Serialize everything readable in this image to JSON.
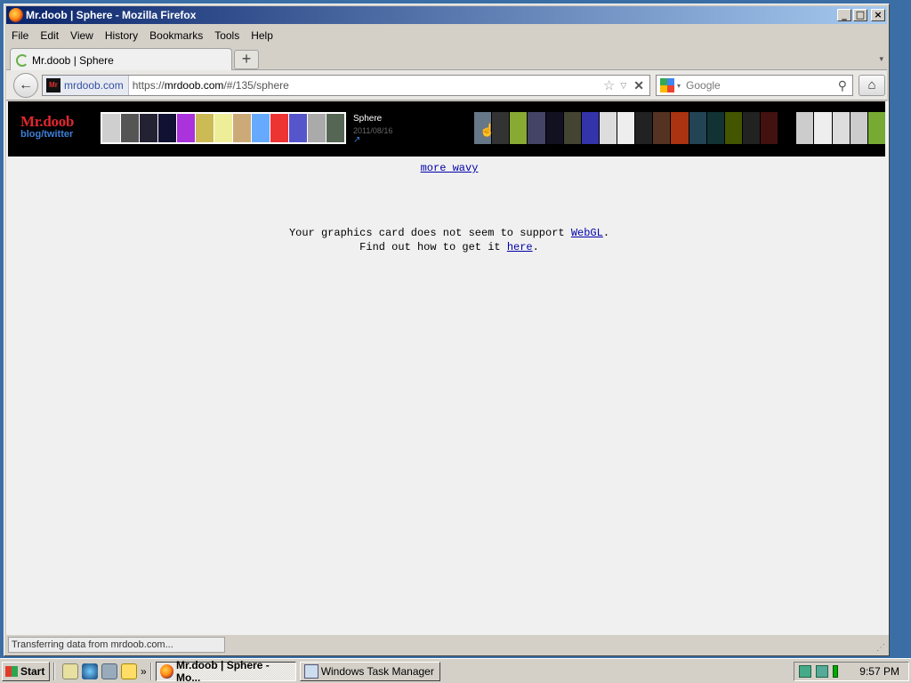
{
  "window": {
    "title": "Mr.doob | Sphere - Mozilla Firefox",
    "min_glyph": "_",
    "max_glyph": "□",
    "close_glyph": "×"
  },
  "menu": [
    "File",
    "Edit",
    "View",
    "History",
    "Bookmarks",
    "Tools",
    "Help"
  ],
  "tab": {
    "label": "Mr.doob | Sphere",
    "new_tab_glyph": "+",
    "list_glyph": "▾"
  },
  "nav": {
    "back_glyph": "←",
    "identity_domain": "mrdoob.com",
    "favicon_text": "Mr",
    "url_prefix": "https://",
    "url_host": "mrdoob.com",
    "url_path": "/#/135/sphere",
    "star_glyph": "☆",
    "drop_glyph": "▽",
    "stop_glyph": "✕",
    "search_placeholder": "Google",
    "search_drop_glyph": "▾",
    "search_glyph": "⚲",
    "home_glyph": "⌂"
  },
  "banner": {
    "logo_name": "Mr.doob",
    "logo_sub": "blog/twitter",
    "active_title": "Sphere",
    "active_date": "2011/08/16",
    "active_link_glyph": "↗",
    "thumbs_left_colors": [
      "#cfcfcf",
      "#555",
      "#223",
      "#113",
      "#a3d",
      "#cb5",
      "#ee9",
      "#ca7",
      "#6af",
      "#e33",
      "#55c",
      "#aaa",
      "#565"
    ],
    "thumbs_right_colors": [
      "#678",
      "#333",
      "#8a3",
      "#446",
      "#112",
      "#443",
      "#33a",
      "#ddd",
      "#eee",
      "#222",
      "#532",
      "#a31",
      "#245",
      "#133",
      "#450",
      "#222",
      "#411",
      "#000",
      "#ccc",
      "#eee",
      "#ddd",
      "#ccc",
      "#7a3"
    ]
  },
  "content": {
    "more_link": "more wavy",
    "msg_line1_pre": "Your graphics card does not seem to support ",
    "msg_link1": "WebGL",
    "msg_line1_post": ".",
    "msg_line2_pre": "Find out how to get it ",
    "msg_link2": "here",
    "msg_line2_post": "."
  },
  "status": {
    "text": "Transferring data from mrdoob.com..."
  },
  "taskbar": {
    "start_label": "Start",
    "chevron": "»",
    "tasks": [
      {
        "label": "Mr.doob | Sphere - Mo...",
        "active": true
      },
      {
        "label": "Windows Task Manager",
        "active": false
      }
    ],
    "clock": "9:57 PM"
  }
}
